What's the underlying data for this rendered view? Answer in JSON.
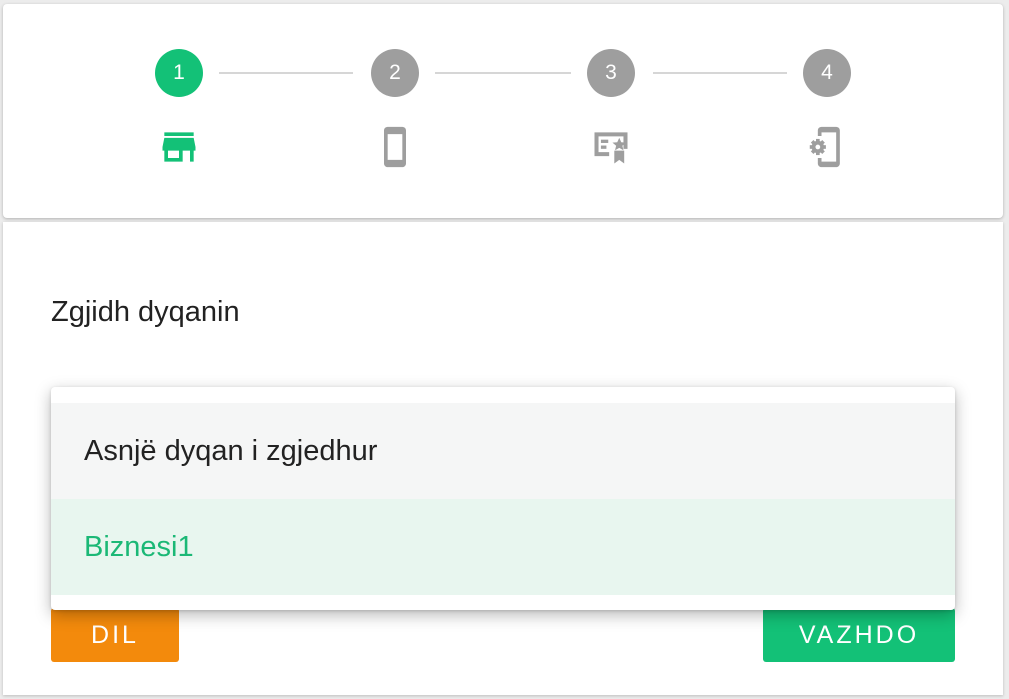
{
  "stepper": {
    "steps": [
      {
        "number": "1",
        "icon": "store-icon",
        "state": "active"
      },
      {
        "number": "2",
        "icon": "smartphone-icon",
        "state": "inactive"
      },
      {
        "number": "3",
        "icon": "loyalty-card-icon",
        "state": "inactive"
      },
      {
        "number": "4",
        "icon": "device-settings-icon",
        "state": "inactive"
      }
    ]
  },
  "colors": {
    "accent": "#13c177",
    "inactive": "#9e9e9e",
    "cancel": "#f38a0c",
    "selected_bg": "#e8f6ef"
  },
  "main": {
    "heading": "Zgjidh dyqanin",
    "dropdown": {
      "options": [
        {
          "label": "Asnjë dyqan i zgjedhur",
          "selected": false
        },
        {
          "label": "Biznesi1",
          "selected": true
        }
      ]
    },
    "buttons": {
      "cancel_label": "DIL",
      "continue_label": "VAZHDO"
    }
  }
}
